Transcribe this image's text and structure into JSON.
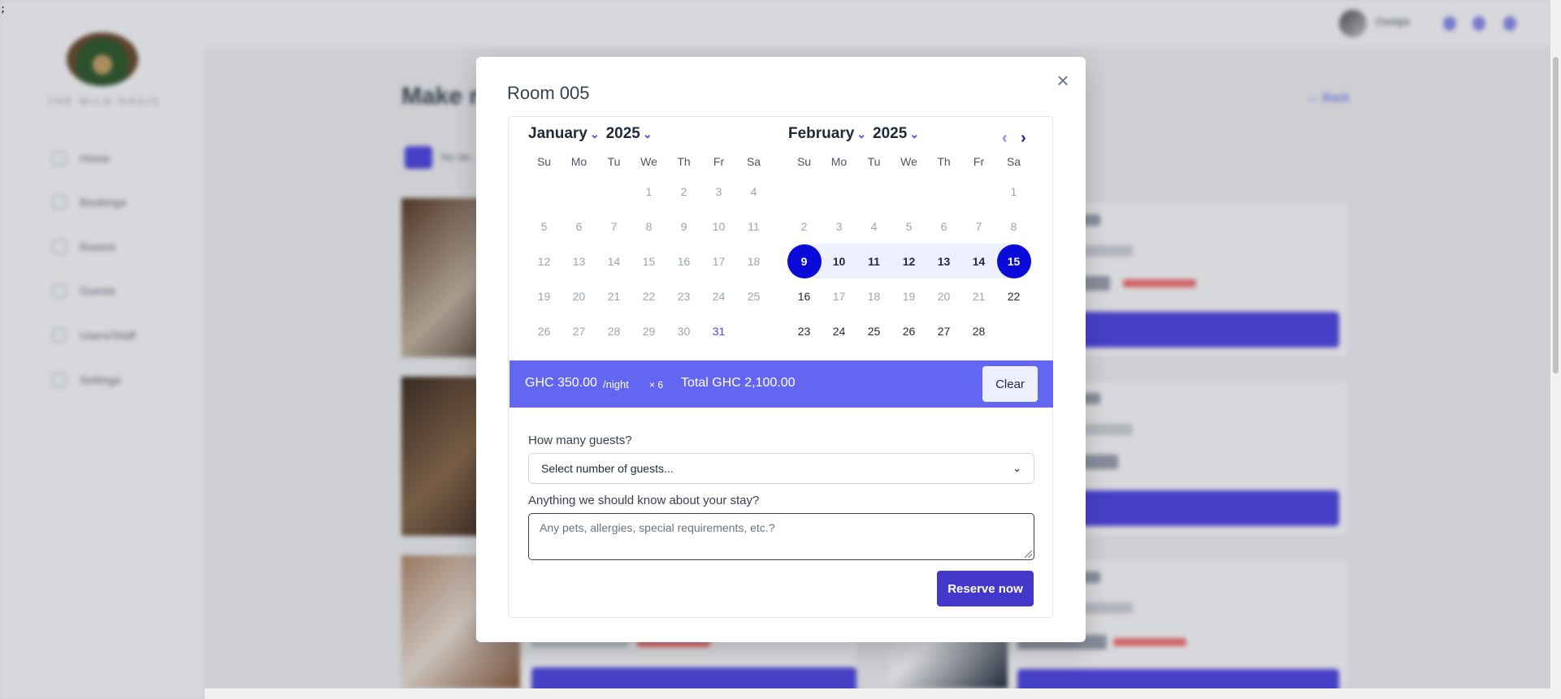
{
  "stray_text": ";",
  "app": {
    "brand": "THE WILD OASIS",
    "nav": [
      {
        "label": "Home",
        "icon": "home-icon"
      },
      {
        "label": "Bookings",
        "icon": "calendar-icon"
      },
      {
        "label": "Rooms",
        "icon": "room-icon"
      },
      {
        "label": "Guests",
        "icon": "guests-icon"
      },
      {
        "label": "Users/Staff",
        "icon": "users-icon"
      },
      {
        "label": "Settings",
        "icon": "settings-icon"
      }
    ],
    "user_name": "Oselgis",
    "page_title": "Make r",
    "back_link": "← Back",
    "filter_text": "No dis"
  },
  "modal": {
    "title": "Room 005",
    "weekdays": [
      "Su",
      "Mo",
      "Tu",
      "We",
      "Th",
      "Fr",
      "Sa"
    ],
    "months": [
      {
        "month": "January",
        "year": "2025",
        "days": [
          {
            "n": ""
          },
          {
            "n": ""
          },
          {
            "n": ""
          },
          {
            "n": "1"
          },
          {
            "n": "2"
          },
          {
            "n": "3"
          },
          {
            "n": "4"
          },
          {
            "n": "5"
          },
          {
            "n": "6"
          },
          {
            "n": "7"
          },
          {
            "n": "8"
          },
          {
            "n": "9"
          },
          {
            "n": "10"
          },
          {
            "n": "11"
          },
          {
            "n": "12"
          },
          {
            "n": "13"
          },
          {
            "n": "14"
          },
          {
            "n": "15"
          },
          {
            "n": "16"
          },
          {
            "n": "17"
          },
          {
            "n": "18"
          },
          {
            "n": "19"
          },
          {
            "n": "20"
          },
          {
            "n": "21"
          },
          {
            "n": "22"
          },
          {
            "n": "23"
          },
          {
            "n": "24"
          },
          {
            "n": "25"
          },
          {
            "n": "26"
          },
          {
            "n": "27"
          },
          {
            "n": "28"
          },
          {
            "n": "29"
          },
          {
            "n": "30"
          },
          {
            "n": "31",
            "state": "today"
          }
        ]
      },
      {
        "month": "February",
        "year": "2025",
        "days": [
          {
            "n": ""
          },
          {
            "n": ""
          },
          {
            "n": ""
          },
          {
            "n": ""
          },
          {
            "n": ""
          },
          {
            "n": ""
          },
          {
            "n": "1"
          },
          {
            "n": "2"
          },
          {
            "n": "3"
          },
          {
            "n": "4"
          },
          {
            "n": "5"
          },
          {
            "n": "6"
          },
          {
            "n": "7"
          },
          {
            "n": "8"
          },
          {
            "n": "9",
            "state": "start"
          },
          {
            "n": "10",
            "state": "range"
          },
          {
            "n": "11",
            "state": "range"
          },
          {
            "n": "12",
            "state": "range"
          },
          {
            "n": "13",
            "state": "range"
          },
          {
            "n": "14",
            "state": "range"
          },
          {
            "n": "15",
            "state": "end"
          },
          {
            "n": "16",
            "state": "avail"
          },
          {
            "n": "17"
          },
          {
            "n": "18"
          },
          {
            "n": "19"
          },
          {
            "n": "20"
          },
          {
            "n": "21"
          },
          {
            "n": "22",
            "state": "avail"
          },
          {
            "n": "23",
            "state": "avail"
          },
          {
            "n": "24",
            "state": "avail"
          },
          {
            "n": "25",
            "state": "avail"
          },
          {
            "n": "26",
            "state": "avail"
          },
          {
            "n": "27",
            "state": "avail"
          },
          {
            "n": "28",
            "state": "avail"
          }
        ]
      }
    ],
    "price": "GHC 350.00",
    "price_unit": "/night",
    "nights": "× 6",
    "total": "Total GHC 2,100.00",
    "clear_label": "Clear",
    "guests_label": "How many guests?",
    "guests_placeholder": "Select number of guests...",
    "notes_label": "Anything we should know about your stay?",
    "notes_placeholder": "Any pets, allergies, special requirements, etc.?",
    "reserve_label": "Reserve now"
  },
  "colors": {
    "accent": "#4f46e5",
    "price_bar": "#6366f1",
    "selected_day": "#0b0bd9",
    "range_fill": "#eef0ff"
  }
}
